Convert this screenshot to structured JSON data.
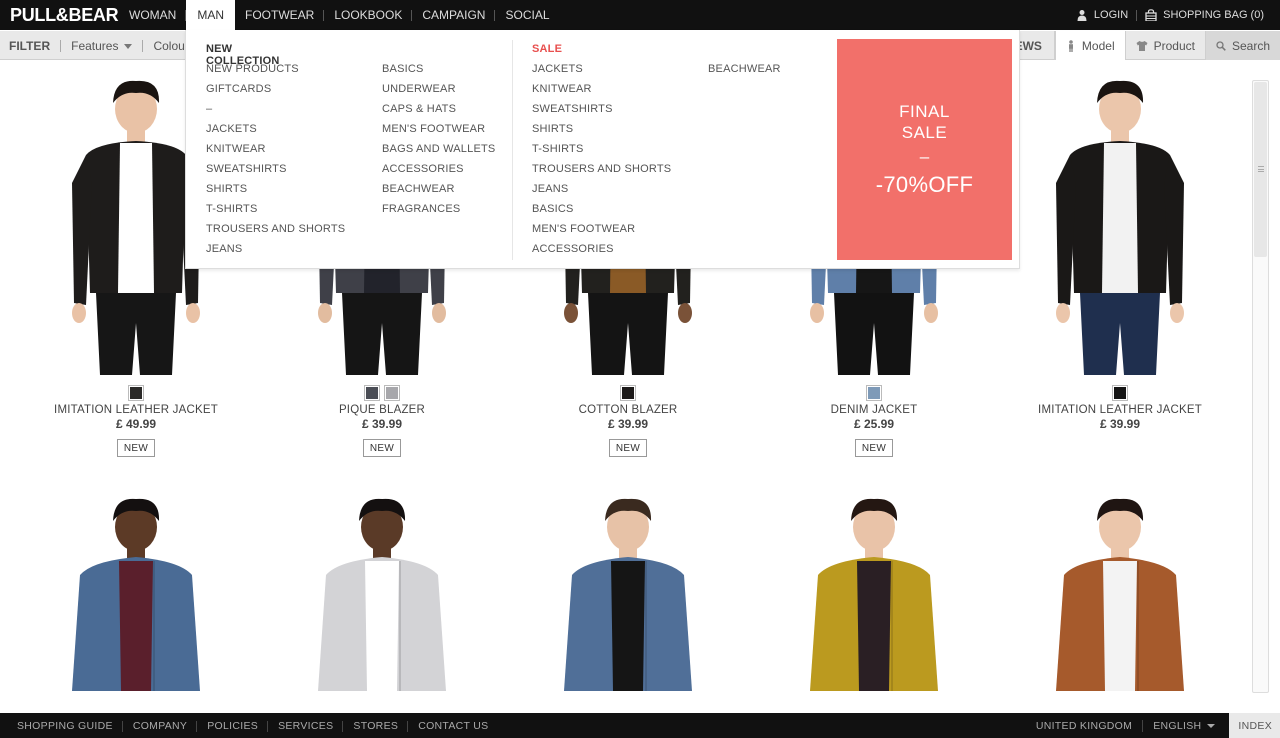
{
  "brand": {
    "logo": "PULL&BEAR"
  },
  "nav": {
    "items": [
      {
        "label": "WOMAN",
        "active": false
      },
      {
        "label": "MAN",
        "active": true
      },
      {
        "label": "FOOTWEAR",
        "active": false
      },
      {
        "label": "LOOKBOOK",
        "active": false
      },
      {
        "label": "CAMPAIGN",
        "active": false
      },
      {
        "label": "SOCIAL",
        "active": false
      }
    ],
    "login": "LOGIN",
    "bag": "SHOPPING BAG (0)"
  },
  "filterbar": {
    "title": "FILTER",
    "features": "Features",
    "colour": "Colour",
    "views": "VIEWS",
    "view_model": "Model",
    "view_product": "Product",
    "search": "Search"
  },
  "megamenu": {
    "new_collection": {
      "heading": "NEW COLLECTION",
      "col1": [
        "NEW PRODUCTS",
        "GIFTCARDS",
        "–",
        "JACKETS",
        "KNITWEAR",
        "SWEATSHIRTS",
        "SHIRTS",
        "T-SHIRTS",
        "TROUSERS AND SHORTS",
        "JEANS"
      ],
      "col2": [
        "BASICS",
        "UNDERWEAR",
        "CAPS & HATS",
        "MEN'S FOOTWEAR",
        "BAGS AND WALLETS",
        "ACCESSORIES",
        "BEACHWEAR",
        "FRAGRANCES"
      ]
    },
    "sale": {
      "heading": "SALE",
      "col1": [
        "JACKETS",
        "KNITWEAR",
        "SWEATSHIRTS",
        "SHIRTS",
        "T-SHIRTS",
        "TROUSERS AND SHORTS",
        "JEANS",
        "BASICS",
        "MEN'S FOOTWEAR",
        "ACCESSORIES"
      ],
      "col2": [
        "BEACHWEAR"
      ]
    },
    "promo": {
      "line1": "FINAL",
      "line2": "SALE",
      "dash": "–",
      "offer": "-70%OFF",
      "color": "#f2706a"
    }
  },
  "products": [
    {
      "name": "IMITATION LEATHER JACKET",
      "price": "£ 49.99",
      "badge": "NEW",
      "swatches": [
        "#2b2a28"
      ],
      "jacket": "#1e1c1b",
      "shirt": "#ffffff",
      "pants": "#161616",
      "skin": "#e9c2a6",
      "hair": "#1a1411"
    },
    {
      "name": "PIQUE BLAZER",
      "price": "£ 39.99",
      "badge": "NEW",
      "swatches": [
        "#4a4d55",
        "#a7a7ab"
      ],
      "jacket": "#3f4048",
      "shirt": "#22232b",
      "pants": "#151515",
      "skin": "#e2bc9f",
      "hair": "#1a1411"
    },
    {
      "name": "COTTON BLAZER",
      "price": "£ 39.99",
      "badge": "NEW",
      "swatches": [
        "#1c1a19"
      ],
      "jacket": "#22211e",
      "shirt": "#8a5a26",
      "pants": "#141414",
      "skin": "#7a5238",
      "hair": "#1a1411"
    },
    {
      "name": "DENIM JACKET",
      "price": "£ 25.99",
      "badge": "NEW",
      "swatches": [
        "#7e9ab8"
      ],
      "jacket": "#5f7fa9",
      "shirt": "#161616",
      "pants": "#121212",
      "skin": "#e7c0a3",
      "hair": "#1a1411"
    },
    {
      "name": "IMITATION LEATHER JACKET",
      "price": "£ 39.99",
      "badge": "",
      "swatches": [
        "#141414"
      ],
      "jacket": "#1a1817",
      "shirt": "#f2f2f2",
      "pants": "#1f2f4e",
      "skin": "#ebc6ab",
      "hair": "#1a1411"
    },
    {
      "name": "",
      "price": "",
      "badge": "",
      "swatches": [],
      "jacket": "#4a6b95",
      "shirt": "#5a1f2c",
      "pants": "#222222",
      "skin": "#5c3a26",
      "hair": "#141010"
    },
    {
      "name": "",
      "price": "",
      "badge": "",
      "swatches": [],
      "jacket": "#d3d3d6",
      "shirt": "#ffffff",
      "pants": "#222222",
      "skin": "#5a3a27",
      "hair": "#141010"
    },
    {
      "name": "",
      "price": "",
      "badge": "",
      "swatches": [],
      "jacket": "#506f98",
      "shirt": "#151515",
      "pants": "#222222",
      "skin": "#e7c2a7",
      "hair": "#3a2a1f"
    },
    {
      "name": "",
      "price": "",
      "badge": "",
      "swatches": [],
      "jacket": "#bb9a1f",
      "shirt": "#2a1f24",
      "pants": "#222222",
      "skin": "#e9c3a8",
      "hair": "#241712"
    },
    {
      "name": "",
      "price": "",
      "badge": "",
      "swatches": [],
      "jacket": "#a65a2c",
      "shirt": "#f3f3f3",
      "pants": "#222222",
      "skin": "#ebc6ab",
      "hair": "#1f1512"
    }
  ],
  "footer": {
    "links": [
      "SHOPPING GUIDE",
      "COMPANY",
      "POLICIES",
      "SERVICES",
      "STORES",
      "CONTACT US"
    ],
    "country": "UNITED KINGDOM",
    "language": "ENGLISH",
    "index": "INDEX"
  }
}
